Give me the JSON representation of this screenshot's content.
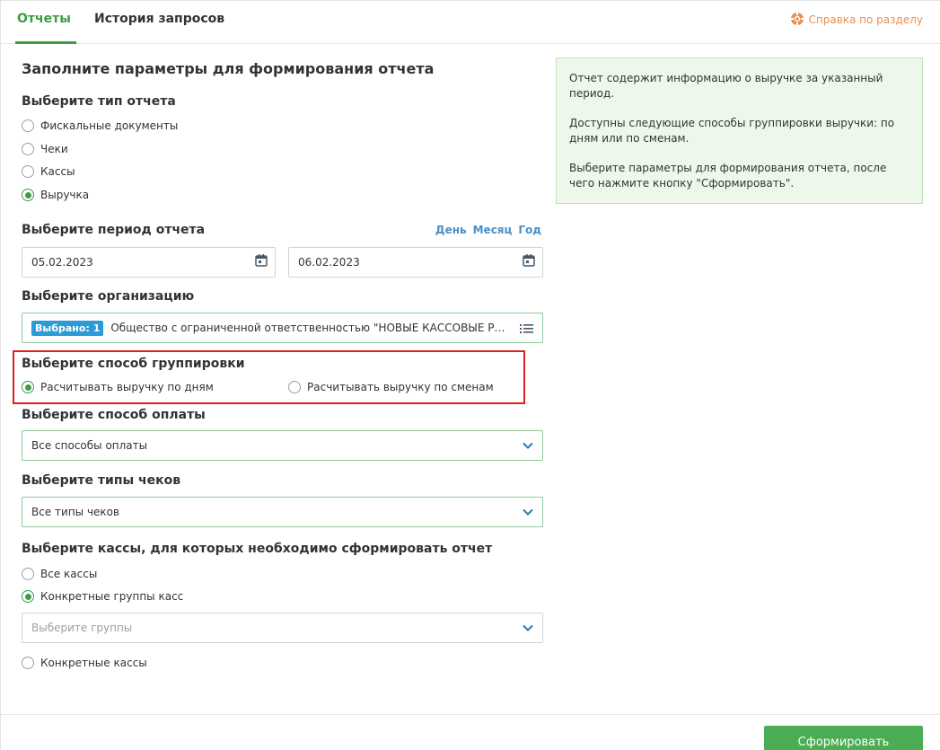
{
  "tabs": [
    {
      "label": "Отчеты",
      "active": true
    },
    {
      "label": "История запросов",
      "active": false
    }
  ],
  "help": {
    "label": "Справка по разделу",
    "icon": "lifebuoy-icon",
    "color": "#e89052"
  },
  "form": {
    "title": "Заполните параметры для формирования отчета",
    "report_type": {
      "title": "Выберите тип отчета",
      "options": [
        "Фискальные документы",
        "Чеки",
        "Кассы",
        "Выручка"
      ],
      "selected": "Выручка"
    },
    "period": {
      "title": "Выберите период отчета",
      "links": [
        "День",
        "Месяц",
        "Год"
      ],
      "date_from": "05.02.2023",
      "date_to": "06.02.2023"
    },
    "organization": {
      "title": "Выберите организацию",
      "badge": "Выбрано: 1",
      "value": "Общество с ограниченной ответственностью \"НОВЫЕ КАССОВЫЕ РЕ..."
    },
    "grouping": {
      "title": "Выберите способ группировки",
      "options": [
        "Расчитывать выручку по дням",
        "Расчитывать выручку по сменам"
      ],
      "selected": "Расчитывать выручку по дням"
    },
    "payment": {
      "title": "Выберите способ оплаты",
      "value": "Все способы оплаты"
    },
    "receipt_types": {
      "title": "Выберите типы чеков",
      "value": "Все типы чеков"
    },
    "registers": {
      "title": "Выберите кассы, для которых необходимо сформировать отчет",
      "options": [
        "Все кассы",
        "Конкретные группы касс",
        "Конкретные кассы"
      ],
      "selected": "Конкретные группы касс",
      "groups_placeholder": "Выберите группы"
    }
  },
  "info": {
    "paragraphs": [
      "Отчет содержит информацию о выручке за указанный период.",
      "Доступны следующие способы группировки выручки: по дням или по сменам.",
      "Выберите параметры для формирования отчета, после чего нажмите кнопку \"Сформировать\"."
    ]
  },
  "submit_label": "Сформировать",
  "colors": {
    "accent": "#3d9b46",
    "link": "#4a90c8",
    "badge": "#2d9ad8",
    "highlight": "#e01e1e",
    "button": "#4aad54"
  }
}
